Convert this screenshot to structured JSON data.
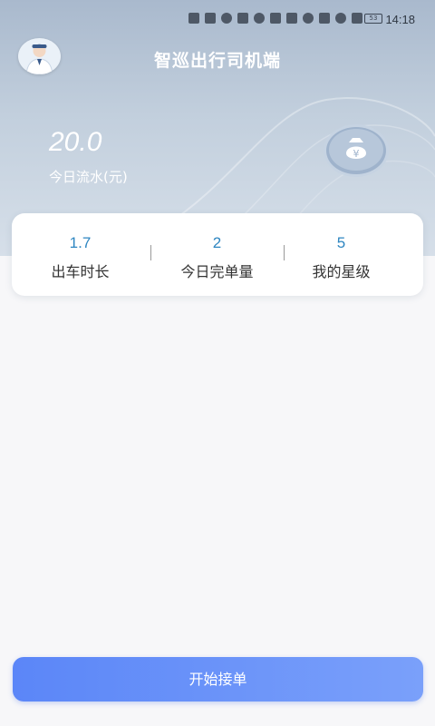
{
  "status_bar": {
    "time": "14:18",
    "battery": "53",
    "icons": [
      "hd-icon",
      "4g-signal-icon",
      "wifi-icon",
      "app-notification-icon",
      "location-icon",
      "play-icon",
      "nfc-icon",
      "alarm-icon",
      "bluetooth-icon",
      "gps-icon",
      "mute-icon",
      "battery-icon",
      "leaf-icon"
    ]
  },
  "header": {
    "app_title": "智巡出行司机端"
  },
  "earnings": {
    "value": "20.0",
    "label": "今日流水(元)"
  },
  "stats": [
    {
      "value": "1.7",
      "label": "出车时长"
    },
    {
      "value": "2",
      "label": "今日完单量"
    },
    {
      "value": "5",
      "label": "我的星级"
    }
  ],
  "actions": {
    "start_label": "开始接单"
  },
  "colors": {
    "accent": "#2e86c1",
    "button_start": "#5b86f8",
    "button_end": "#7aa0fa",
    "header_top": "#a9b9cd"
  }
}
